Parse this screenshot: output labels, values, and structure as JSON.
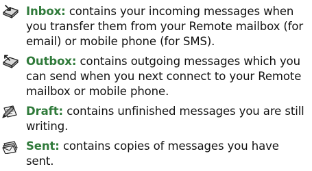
{
  "entries": [
    {
      "icon": "inbox-icon",
      "term": "Inbox:",
      "description": " contains your incoming messages when you transfer them from your Remote mailbox (for email) or mobile phone (for SMS)."
    },
    {
      "icon": "outbox-icon",
      "term": "Outbox:",
      "description": " contains outgoing messages which you can send when you next connect to your Remote mailbox or mobile phone."
    },
    {
      "icon": "draft-icon",
      "term": "Draft:",
      "description": " contains unfinished messages you are still writing."
    },
    {
      "icon": "sent-icon",
      "term": "Sent:",
      "description": " contains copies of messages you have sent."
    }
  ],
  "colors": {
    "term": "#2f7a3a",
    "text": "#111111"
  }
}
